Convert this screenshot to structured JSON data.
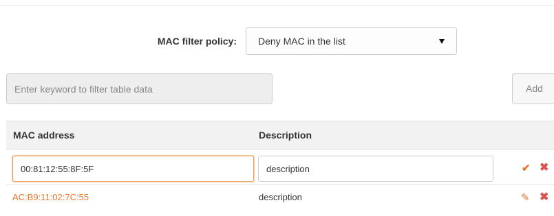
{
  "policy": {
    "label": "MAC filter policy:",
    "selected": "Deny MAC in the list"
  },
  "filter": {
    "placeholder": "Enter keyword to filter table data"
  },
  "toolbar": {
    "add_label": "Add"
  },
  "table": {
    "headers": [
      "MAC address",
      "Description"
    ],
    "edit_row": {
      "mac": "00:81:12:55:8F:5F",
      "description": "description"
    },
    "rows": [
      {
        "mac": "AC:B9:11:02:7C:55",
        "description": "description"
      }
    ]
  },
  "icons": {
    "confirm": "check-icon",
    "delete": "close-icon",
    "edit": "pencil-icon"
  },
  "colors": {
    "accent": "#e8762b",
    "danger": "#d9534f",
    "header_bg": "#f2f2f2"
  }
}
